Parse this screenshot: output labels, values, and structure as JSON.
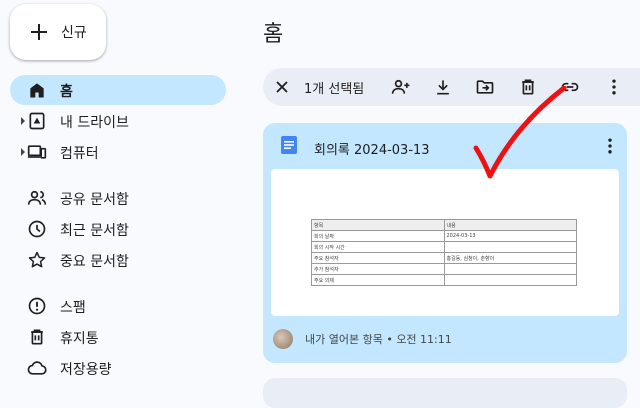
{
  "sidebar": {
    "new_button": {
      "label": "신규",
      "icon": "plus-icon"
    },
    "items": [
      {
        "label": "홈",
        "icon": "home-icon",
        "active": true,
        "expandable": false
      },
      {
        "label": "내 드라이브",
        "icon": "my-drive-icon",
        "active": false,
        "expandable": true
      },
      {
        "label": "컴퓨터",
        "icon": "computer-icon",
        "active": false,
        "expandable": true
      },
      {
        "label": "공유 문서함",
        "icon": "people-icon",
        "active": false,
        "expandable": false
      },
      {
        "label": "최근 문서함",
        "icon": "clock-icon",
        "active": false,
        "expandable": false
      },
      {
        "label": "중요 문서함",
        "icon": "star-icon",
        "active": false,
        "expandable": false
      },
      {
        "label": "스팸",
        "icon": "spam-icon",
        "active": false,
        "expandable": false
      },
      {
        "label": "휴지통",
        "icon": "trash-icon",
        "active": false,
        "expandable": false
      },
      {
        "label": "저장용량",
        "icon": "cloud-icon",
        "active": false,
        "expandable": false
      }
    ]
  },
  "main": {
    "page_title": "홈",
    "selection_toolbar": {
      "selected_label": "1개 선택됨",
      "actions": [
        "close-icon",
        "share-icon",
        "download-icon",
        "move-to-folder-icon",
        "trash-icon",
        "link-icon",
        "more-vert-icon"
      ]
    },
    "file_card": {
      "title": "회의록 2024-03-13",
      "icon": "google-docs-icon",
      "footer": "내가 열어본 항목 • 오전 11:11",
      "preview_table": {
        "header": [
          "항목",
          "내용"
        ],
        "rows": [
          [
            "회의 날짜",
            "2024-03-13"
          ],
          [
            "회의 시작 시간",
            ""
          ],
          [
            "주요 참석자",
            "홍길동, 심청이, 춘향이"
          ],
          [
            "추가 참석자",
            ""
          ],
          [
            "주요 의제",
            ""
          ]
        ]
      }
    }
  },
  "colors": {
    "background": "#f8fafd",
    "active_nav": "#c2e7ff",
    "selected_card": "#c2e7ff",
    "toolbar": "#e9eef6",
    "docs_blue": "#4285f4",
    "annotation_red": "#ee1111"
  }
}
